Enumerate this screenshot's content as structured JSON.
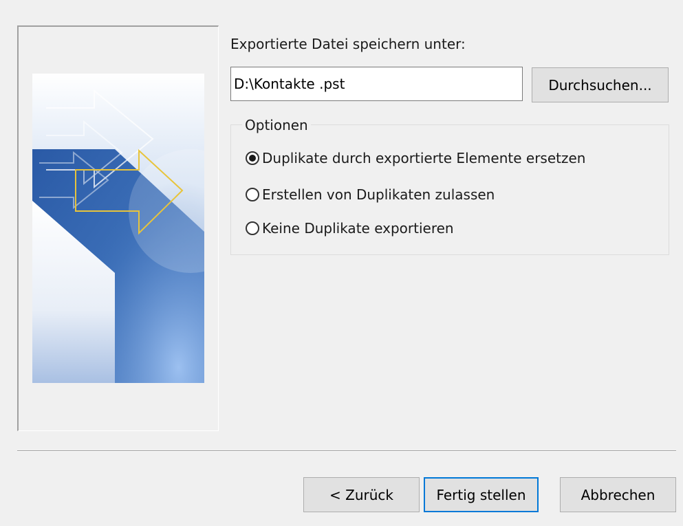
{
  "dialog": {
    "save_as_label": "Exportierte Datei speichern unter:",
    "file_path_value": "D:\\Kontakte .pst",
    "browse_label": "Durchsuchen...",
    "options": {
      "legend": "Optionen",
      "items": [
        {
          "label": "Duplikate durch exportierte Elemente ersetzen",
          "selected": true
        },
        {
          "label": "Erstellen von Duplikaten zulassen",
          "selected": false
        },
        {
          "label": "Keine Duplikate exportieren",
          "selected": false
        }
      ]
    },
    "buttons": {
      "back": "< Zurück",
      "finish": "Fertig stellen",
      "cancel": "Abbrechen"
    }
  },
  "colors": {
    "background": "#f0f0f0",
    "focus_border": "#0078d7",
    "art_blue": "#2f5fa8",
    "art_arrow_yellow": "#e8c43a"
  }
}
